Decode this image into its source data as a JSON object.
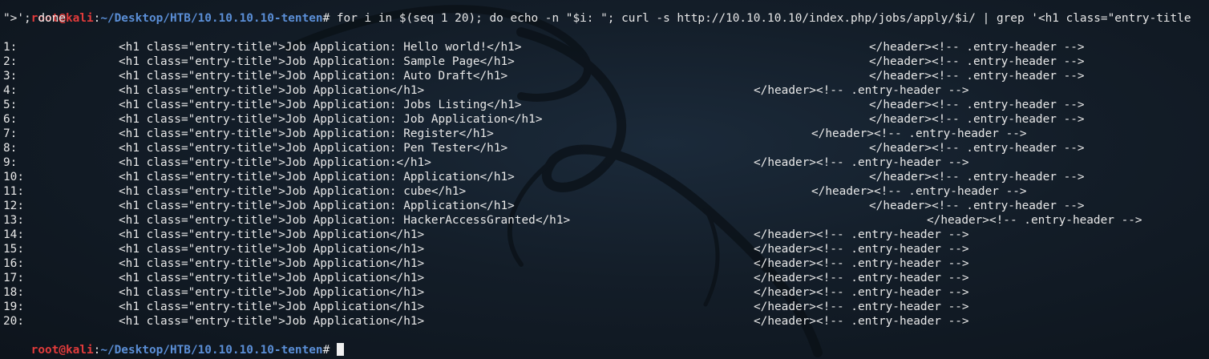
{
  "prompt": {
    "user": "root",
    "at": "@",
    "host": "kali",
    "colon": ":",
    "path": "~/Desktop/HTB/10.10.10.10-tenten",
    "symbol": "# "
  },
  "command_line_1": "for i in $(seq 1 20); do echo -n \"$i: \"; curl -s http://10.10.10.10/index.php/jobs/apply/$i/ | grep '<h1 class=\"entry-title",
  "command_line_2": "\">'; done",
  "output": [
    {
      "num": "1:",
      "h1": "<h1 class=\"entry-title\">Job Application: Hello world!</h1>",
      "tail": "</header><!-- .entry-header -->"
    },
    {
      "num": "2:",
      "h1": "<h1 class=\"entry-title\">Job Application: Sample Page</h1>",
      "tail": "</header><!-- .entry-header -->"
    },
    {
      "num": "3:",
      "h1": "<h1 class=\"entry-title\">Job Application: Auto Draft</h1>",
      "tail": "</header><!-- .entry-header -->"
    },
    {
      "num": "4:",
      "h1": "<h1 class=\"entry-title\">Job Application</h1>",
      "tail": "</header><!-- .entry-header -->"
    },
    {
      "num": "5:",
      "h1": "<h1 class=\"entry-title\">Job Application: Jobs Listing</h1>",
      "tail": "</header><!-- .entry-header -->"
    },
    {
      "num": "6:",
      "h1": "<h1 class=\"entry-title\">Job Application: Job Application</h1>",
      "tail": "</header><!-- .entry-header -->"
    },
    {
      "num": "7:",
      "h1": "<h1 class=\"entry-title\">Job Application: Register</h1>",
      "tail": "</header><!-- .entry-header -->"
    },
    {
      "num": "8:",
      "h1": "<h1 class=\"entry-title\">Job Application: Pen Tester</h1>",
      "tail": "</header><!-- .entry-header -->"
    },
    {
      "num": "9:",
      "h1": "<h1 class=\"entry-title\">Job Application:</h1>",
      "tail": "</header><!-- .entry-header -->"
    },
    {
      "num": "10:",
      "h1": "<h1 class=\"entry-title\">Job Application: Application</h1>",
      "tail": "</header><!-- .entry-header -->"
    },
    {
      "num": "11:",
      "h1": "<h1 class=\"entry-title\">Job Application: cube</h1>",
      "tail": "</header><!-- .entry-header -->"
    },
    {
      "num": "12:",
      "h1": "<h1 class=\"entry-title\">Job Application: Application</h1>",
      "tail": "</header><!-- .entry-header -->"
    },
    {
      "num": "13:",
      "h1": "<h1 class=\"entry-title\">Job Application: HackerAccessGranted</h1>",
      "tail": "</header><!-- .entry-header -->"
    },
    {
      "num": "14:",
      "h1": "<h1 class=\"entry-title\">Job Application</h1>",
      "tail": "</header><!-- .entry-header -->"
    },
    {
      "num": "15:",
      "h1": "<h1 class=\"entry-title\">Job Application</h1>",
      "tail": "</header><!-- .entry-header -->"
    },
    {
      "num": "16:",
      "h1": "<h1 class=\"entry-title\">Job Application</h1>",
      "tail": "</header><!-- .entry-header -->"
    },
    {
      "num": "17:",
      "h1": "<h1 class=\"entry-title\">Job Application</h1>",
      "tail": "</header><!-- .entry-header -->"
    },
    {
      "num": "18:",
      "h1": "<h1 class=\"entry-title\">Job Application</h1>",
      "tail": "</header><!-- .entry-header -->"
    },
    {
      "num": "19:",
      "h1": "<h1 class=\"entry-title\">Job Application</h1>",
      "tail": "</header><!-- .entry-header -->"
    },
    {
      "num": "20:",
      "h1": "<h1 class=\"entry-title\">Job Application</h1>",
      "tail": "</header><!-- .entry-header -->"
    }
  ],
  "colors": {
    "background": "#131d28",
    "prompt_user": "#e23b3b",
    "prompt_path": "#5a8ed6",
    "text": "#e8e8e8"
  },
  "icons": {
    "background_logo": "kali-dragon-logo"
  }
}
